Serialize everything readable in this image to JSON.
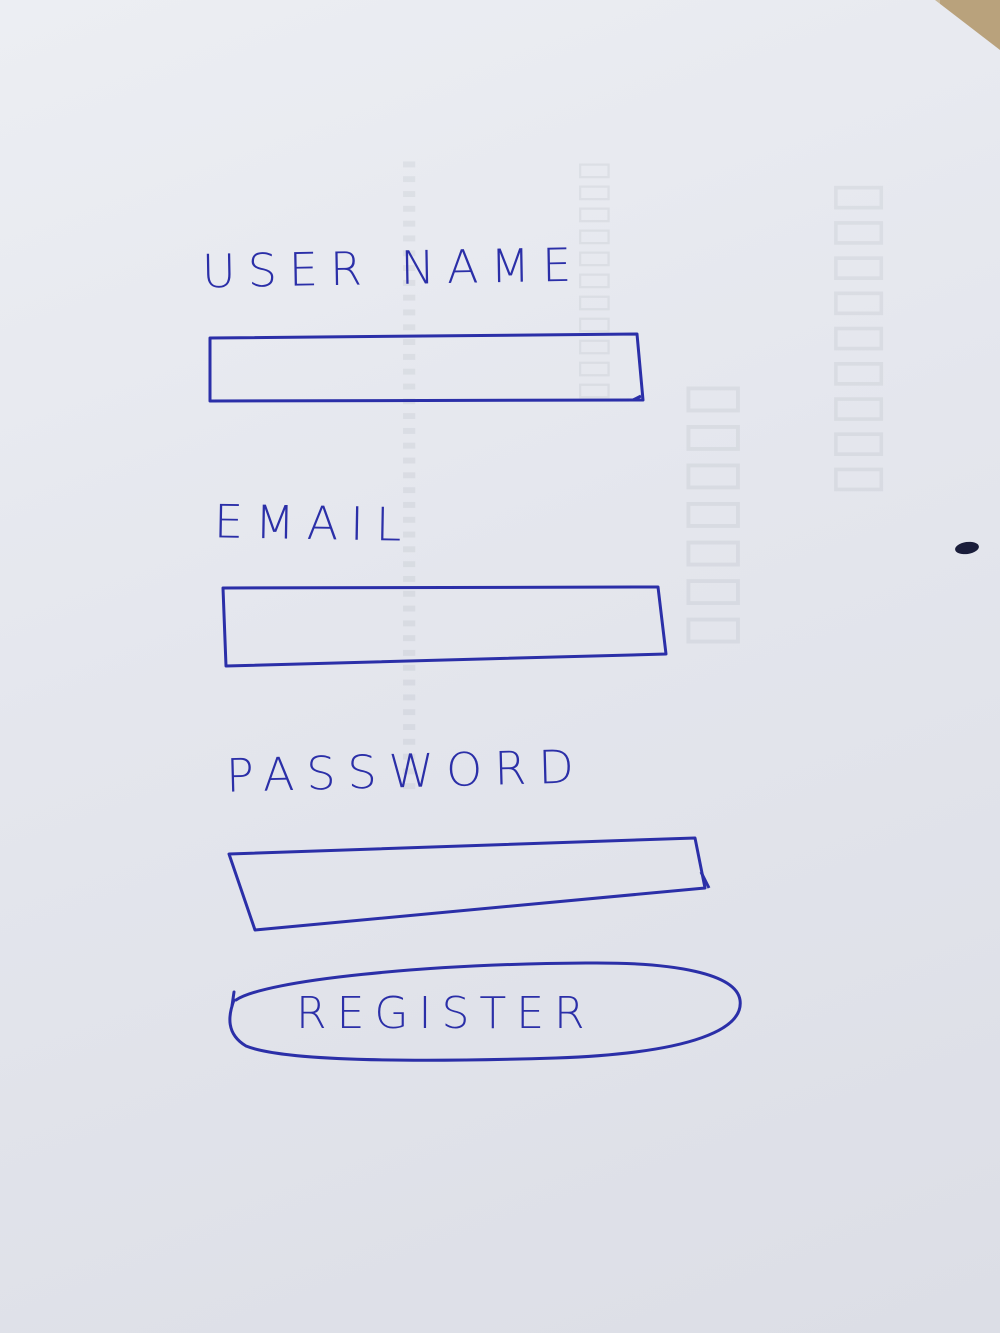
{
  "form": {
    "username_label": "USER NAME",
    "email_label": "EMAIL",
    "password_label": "PASSWORD",
    "register_label": "REGISTER"
  },
  "colors": {
    "ink": "#2b2fa8",
    "paper": "#e6e8ee"
  }
}
